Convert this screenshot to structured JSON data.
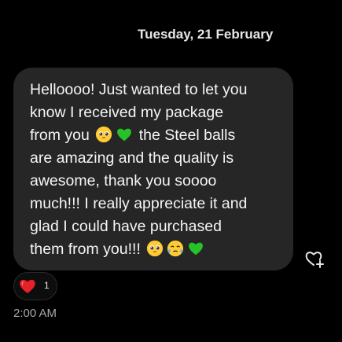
{
  "date_header": "Tuesday, 21 February",
  "message": {
    "lines": [
      "Helloooo! Just wanted to let you",
      "know I received my package",
      "from you",
      "the Steel balls",
      "are amazing and the quality is",
      "awesome, thank you soooo",
      "much!!! I really appreciate it and",
      "glad I could have purchased",
      "them from you!!!"
    ],
    "emojis_line3": [
      "pleading-face-emoji",
      "green-heart-emoji"
    ],
    "emojis_line9": [
      "pleading-face-emoji",
      "face-holding-back-tears-emoji",
      "green-heart-emoji"
    ]
  },
  "reaction": {
    "emoji": "red-heart-emoji",
    "count": "1"
  },
  "timestamp": "2:00 AM",
  "colors": {
    "background": "#000000",
    "bubble": "#262626",
    "text": "#f5f5f5",
    "timestamp": "#a8a8a8",
    "green_heart": "#27c227",
    "red_heart": "#e8202a"
  }
}
